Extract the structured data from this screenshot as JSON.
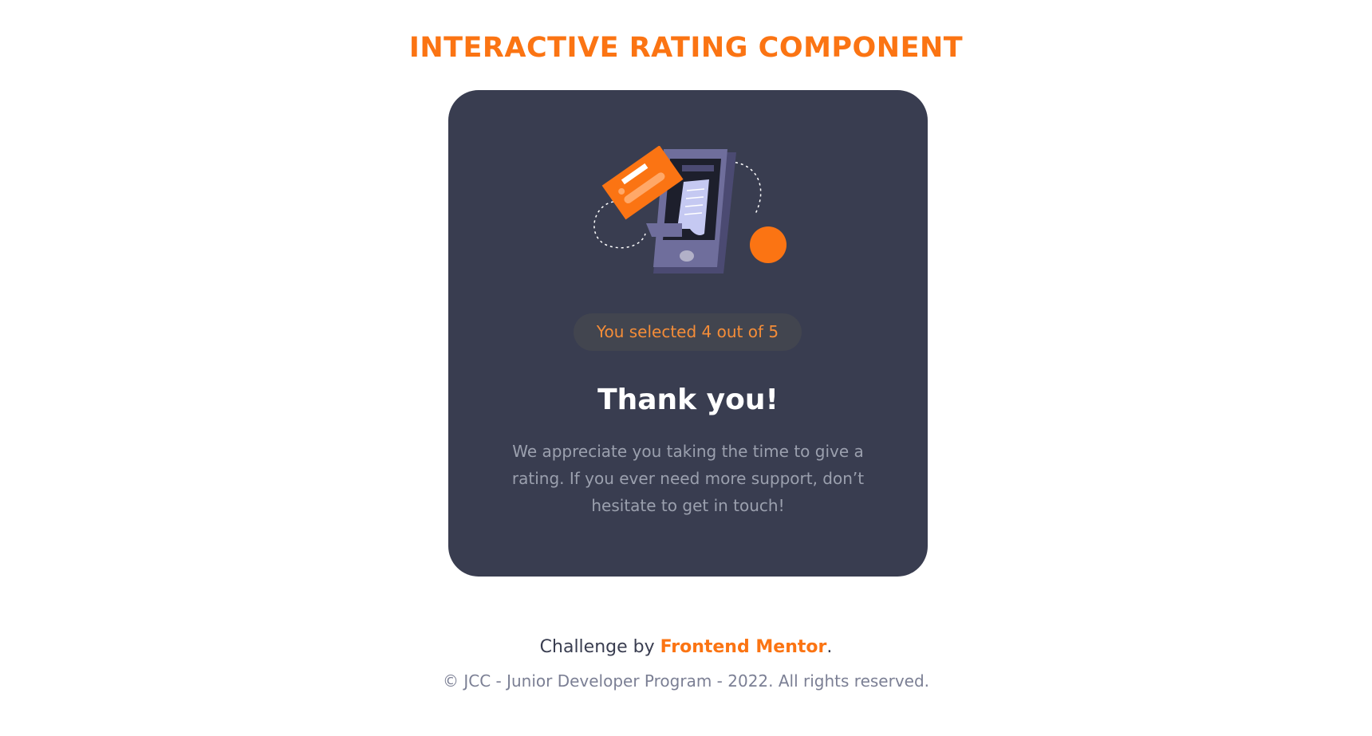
{
  "page": {
    "title": "INTERACTIVE RATING COMPONENT"
  },
  "card": {
    "illustration_icon": "phone-payment-illustration",
    "selection_text": "You selected 4 out of 5",
    "selected_rating": 4,
    "max_rating": 5,
    "heading": "Thank you!",
    "message": "We appreciate you taking the time to give a rating. If you ever need more support, don’t hesitate to get in touch!"
  },
  "footer": {
    "challenge_prefix": "Challenge by ",
    "challenge_link": "Frontend Mentor",
    "challenge_suffix": ".",
    "copyright": "© JCC - Junior Developer Program - 2022. All rights reserved."
  },
  "colors": {
    "accent": "#fb7413",
    "card_bg": "#393d50",
    "pill_bg": "#42454f",
    "text_muted": "#9ba0ae"
  }
}
